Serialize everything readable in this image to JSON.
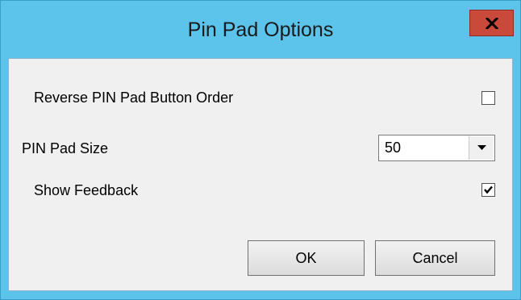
{
  "window": {
    "title": "Pin Pad Options"
  },
  "options": {
    "reverse_order_label": "Reverse PIN Pad Button Order",
    "reverse_order_checked": false,
    "size_label": "PIN Pad Size",
    "size_value": "50",
    "show_feedback_label": "Show Feedback",
    "show_feedback_checked": true
  },
  "buttons": {
    "ok_label": "OK",
    "cancel_label": "Cancel"
  },
  "icons": {
    "close": "close-icon",
    "dropdown": "chevron-down-icon",
    "check": "check-icon"
  },
  "colors": {
    "titlebar": "#5cc4ea",
    "close_button": "#c94a3b",
    "client_background": "#f0f0f0"
  }
}
